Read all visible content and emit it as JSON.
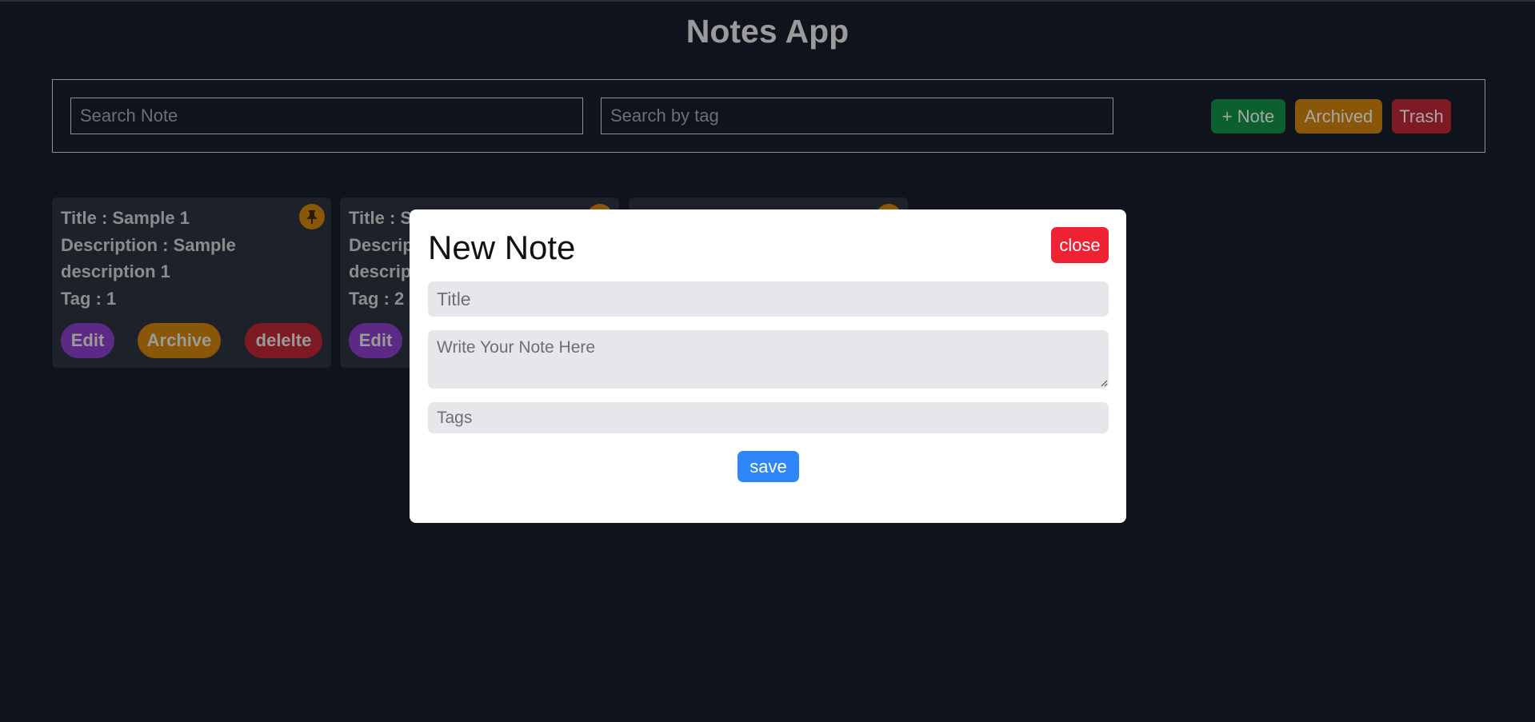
{
  "app": {
    "title": "Notes App"
  },
  "toolbar": {
    "search_note_placeholder": "Search Note",
    "search_tag_placeholder": "Search by tag",
    "add_note_label": "+ Note",
    "archived_label": "Archived",
    "trash_label": "Trash"
  },
  "notes": [
    {
      "title": "Title : Sample 1",
      "description": "Description : Sample description 1",
      "tag": "Tag : 1",
      "edit_label": "Edit",
      "archive_label": "Archive",
      "delete_label": "delelte"
    },
    {
      "title": "Title : Sa",
      "description_1": "Descrip",
      "description_2": "descript",
      "tag": "Tag : 2",
      "edit_label": "Edit"
    },
    {}
  ],
  "modal": {
    "title": "New Note",
    "close_label": "close",
    "title_placeholder": "Title",
    "body_placeholder": "Write Your Note Here",
    "tags_placeholder": "Tags",
    "save_label": "save"
  },
  "colors": {
    "background": "#0f131c",
    "add_note": "#0c5f2f",
    "archived": "#8a5709",
    "trash": "#7e1a23",
    "edit": "#5c2a86",
    "close": "#ee2233",
    "save": "#2f86f7"
  },
  "icons": {
    "pin": "pin-icon",
    "resize": "resize-grip-icon"
  }
}
